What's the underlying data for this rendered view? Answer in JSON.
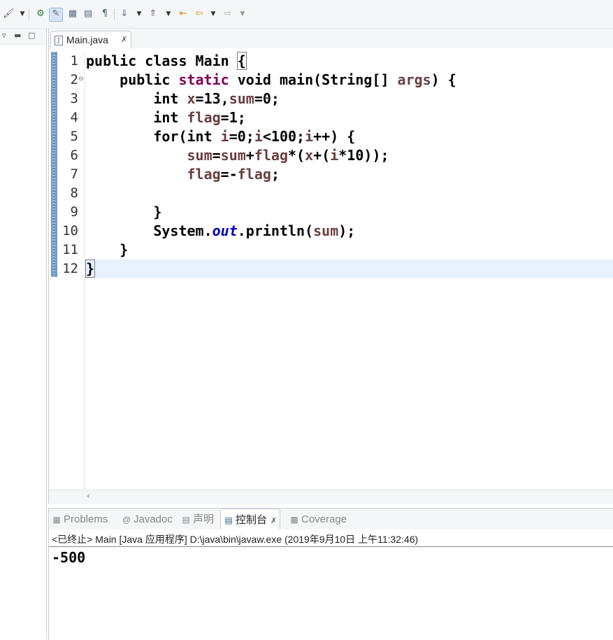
{
  "toolbar": {
    "icons": [
      "pin-icon",
      "chevron-down-icon",
      "debug-icon",
      "highlight-icon",
      "block-select-icon",
      "whitespace-icon",
      "paragraph-icon",
      "next-annotation-icon",
      "chevron-down-icon",
      "prev-annotation-icon",
      "chevron-down-icon",
      "last-edit-icon",
      "back-icon",
      "chevron-down-icon",
      "forward-icon",
      "chevron-down-icon"
    ]
  },
  "editor": {
    "tab_label": "Main.java",
    "line_numbers": [
      "1",
      "2",
      "3",
      "4",
      "5",
      "6",
      "7",
      "8",
      "9",
      "10",
      "11",
      "12"
    ],
    "lines": {
      "l1_a": "public class Main ",
      "l1_b": "{",
      "l2_a": "    public ",
      "l2_b": "static",
      "l2_c": " void main(String[] ",
      "l2_d": "args",
      "l2_e": ") {",
      "l3_a": "        int ",
      "l3_b": "x",
      "l3_c": "=13,",
      "l3_d": "sum",
      "l3_e": "=0;",
      "l4_a": "        int ",
      "l4_b": "flag",
      "l4_c": "=1;",
      "l5_a": "        for(int ",
      "l5_b": "i",
      "l5_c": "=0;",
      "l5_d": "i",
      "l5_e": "<100;",
      "l5_f": "i",
      "l5_g": "++) {",
      "l6_a": "            ",
      "l6_b": "sum",
      "l6_c": "=",
      "l6_d": "sum",
      "l6_e": "+",
      "l6_f": "flag",
      "l6_g": "*(",
      "l6_h": "x",
      "l6_i": "+(",
      "l6_j": "i",
      "l6_k": "*10));",
      "l7_a": "            ",
      "l7_b": "flag",
      "l7_c": "=-",
      "l7_d": "flag",
      "l7_e": ";",
      "l8": "",
      "l9": "        }",
      "l10_a": "        System.",
      "l10_b": "out",
      "l10_c": ".println(",
      "l10_d": "sum",
      "l10_e": ");",
      "l11": "    }",
      "l12": "}"
    }
  },
  "bottom_panel": {
    "tabs": [
      {
        "label": "Problems",
        "icon": "problems-icon"
      },
      {
        "label": "Javadoc",
        "icon": "javadoc-icon"
      },
      {
        "label": "声明",
        "icon": "declaration-icon"
      },
      {
        "label": "控制台",
        "icon": "console-icon"
      },
      {
        "label": "Coverage",
        "icon": "coverage-icon"
      }
    ],
    "console_header": "<已终止> Main [Java 应用程序] D:\\java\\bin\\javaw.exe  (2019年9月10日 上午11:32:46)",
    "console_output": "-500"
  },
  "colors": {
    "keyword": "#7f0055",
    "variable": "#6a3e3e",
    "static_field": "#0000c0",
    "current_line": "#e8f2fe"
  }
}
